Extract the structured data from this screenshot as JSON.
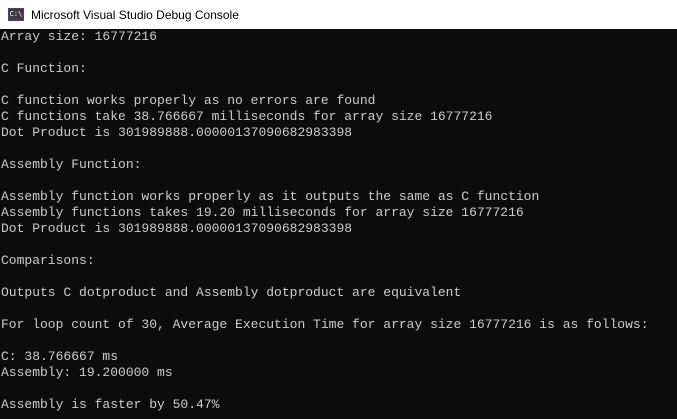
{
  "window": {
    "title": "Microsoft Visual Studio Debug Console",
    "icon_label": "C:\\"
  },
  "console": {
    "lines": [
      "Array size: 16777216",
      "",
      "C Function:",
      "",
      "C function works properly as no errors are found",
      "C functions take 38.766667 milliseconds for array size 16777216",
      "Dot Product is 301989888.00000137090682983398",
      "",
      "Assembly Function:",
      "",
      "Assembly function works properly as it outputs the same as C function",
      "Assembly functions takes 19.20 milliseconds for array size 16777216",
      "Dot Product is 301989888.00000137090682983398",
      "",
      "Comparisons:",
      "",
      "Outputs C dotproduct and Assembly dotproduct are equivalent",
      "",
      "For loop count of 30, Average Execution Time for array size 16777216 is as follows:",
      "",
      "C: 38.766667 ms",
      "Assembly: 19.200000 ms",
      "",
      "Assembly is faster by 50.47%"
    ]
  },
  "colors": {
    "console_background": "#0c0c0c",
    "console_text": "#cccccc",
    "titlebar_background": "#ffffff"
  }
}
